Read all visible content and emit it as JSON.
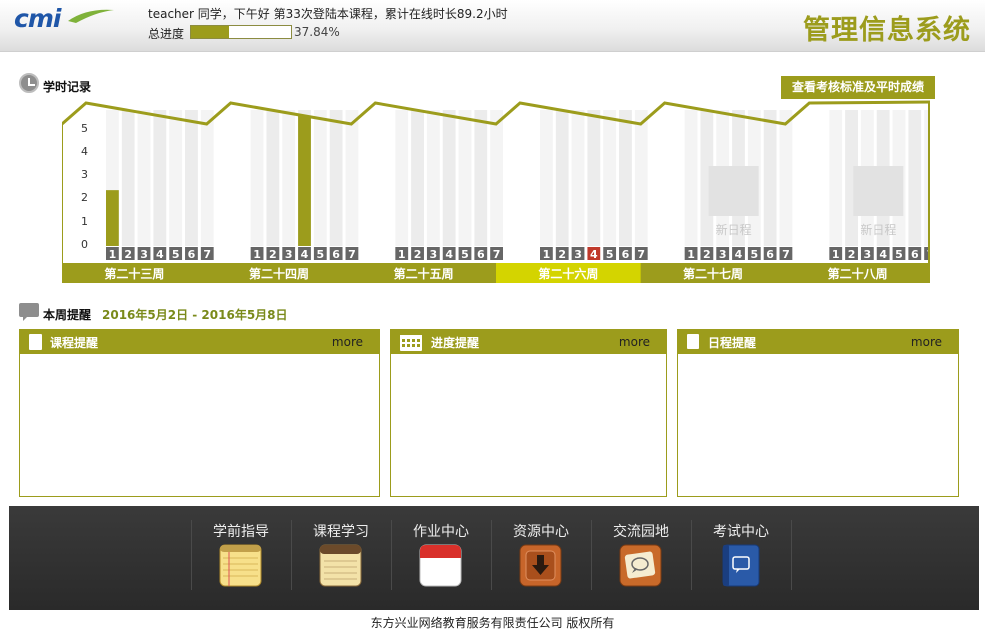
{
  "header": {
    "logo_text": "cmi",
    "greeting": "teacher 同学，下午好  第33次登陆本课程，累计在线时长89.2小时",
    "progress_label": "总进度",
    "progress_value": 0.3784,
    "progress_text": "37.84%",
    "system_title": "管理信息系统"
  },
  "records": {
    "title": "学时记录",
    "criteria_button": "查看考核标准及平时成绩"
  },
  "chart_data": {
    "type": "bar",
    "yticks": [
      "0",
      "1",
      "2",
      "3",
      "4",
      "5"
    ],
    "ylim": [
      0,
      5.5
    ],
    "current_week_index": 3,
    "today_day": 4,
    "weeks": [
      {
        "label": "第二十三周",
        "days": [
          "1",
          "2",
          "3",
          "4",
          "5",
          "6",
          "7"
        ],
        "values": [
          2.4,
          0,
          0,
          0,
          0,
          0,
          0
        ],
        "placeholder": ""
      },
      {
        "label": "第二十四周",
        "days": [
          "1",
          "2",
          "3",
          "4",
          "5",
          "6",
          "7"
        ],
        "values": [
          0,
          0,
          0,
          5.6,
          0,
          0,
          0
        ],
        "placeholder": ""
      },
      {
        "label": "第二十五周",
        "days": [
          "1",
          "2",
          "3",
          "4",
          "5",
          "6",
          "7"
        ],
        "values": [
          0,
          0,
          0,
          0,
          0,
          0,
          0
        ],
        "placeholder": ""
      },
      {
        "label": "第二十六周",
        "days": [
          "1",
          "2",
          "3",
          "4",
          "5",
          "6",
          "7"
        ],
        "values": [
          0,
          0,
          0,
          0,
          0,
          0,
          0
        ],
        "placeholder": ""
      },
      {
        "label": "第二十七周",
        "days": [
          "1",
          "2",
          "3",
          "4",
          "5",
          "6",
          "7"
        ],
        "values": [
          0,
          0,
          0,
          0,
          0,
          0,
          0
        ],
        "placeholder": "新日程"
      },
      {
        "label": "第二十八周",
        "days": [
          "1",
          "2",
          "3",
          "4",
          "5",
          "6",
          "7"
        ],
        "values": [
          0,
          0,
          0,
          0,
          0,
          0,
          0
        ],
        "placeholder": "新日程"
      }
    ],
    "colors": {
      "accent": "#9c9c1c",
      "current": "#d4d400",
      "today": "#c0392b",
      "day_badge": "#666666"
    }
  },
  "reminders": {
    "title": "本周提醒",
    "range": "2016年5月2日  - 2016年5月8日",
    "panels": [
      {
        "title": "课程提醒",
        "more": "more",
        "icon": "document-icon"
      },
      {
        "title": "进度提醒",
        "more": "more",
        "icon": "calendar-grid-icon"
      },
      {
        "title": "日程提醒",
        "more": "more",
        "icon": "note-icon"
      }
    ]
  },
  "nav": {
    "items": [
      {
        "label": "学前指导",
        "icon": "notepad-icon"
      },
      {
        "label": "课程学习",
        "icon": "notes-icon"
      },
      {
        "label": "作业中心",
        "icon": "calendar-icon"
      },
      {
        "label": "资源中心",
        "icon": "download-icon"
      },
      {
        "label": "交流园地",
        "icon": "chat-icon"
      },
      {
        "label": "考试中心",
        "icon": "book-icon"
      }
    ]
  },
  "footer": {
    "copyright": "东方兴业网络教育服务有限责任公司      版权所有"
  }
}
